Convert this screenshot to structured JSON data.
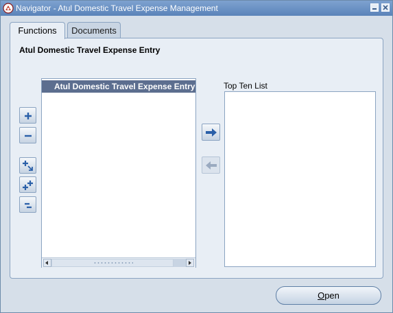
{
  "window": {
    "title": "Navigator - Atul Domestic Travel Expense Management"
  },
  "tabs": [
    {
      "label": "Functions",
      "selected": true
    },
    {
      "label": "Documents",
      "selected": false
    }
  ],
  "section_title": "Atul Domestic Travel Expense Entry",
  "tree": {
    "header": "Atul Domestic Travel Expense Entry"
  },
  "top_ten": {
    "label": "Top Ten List"
  },
  "open_button": {
    "mnemonic": "O",
    "rest": "pen"
  },
  "colors": {
    "titlebar": "#5a83b9",
    "panel": "#e8eef5",
    "tree_header": "#5c6e8f",
    "arrow_blue": "#2a5fa8"
  },
  "icons": {
    "app": "oracle-navigator-icon",
    "expand": "plus-icon",
    "collapse": "minus-icon",
    "expand_branch": "expand-branch-icon",
    "expand_all": "expand-all-icon",
    "collapse_all": "collapse-all-icon",
    "add": "right-arrow-icon",
    "remove": "left-arrow-icon"
  }
}
